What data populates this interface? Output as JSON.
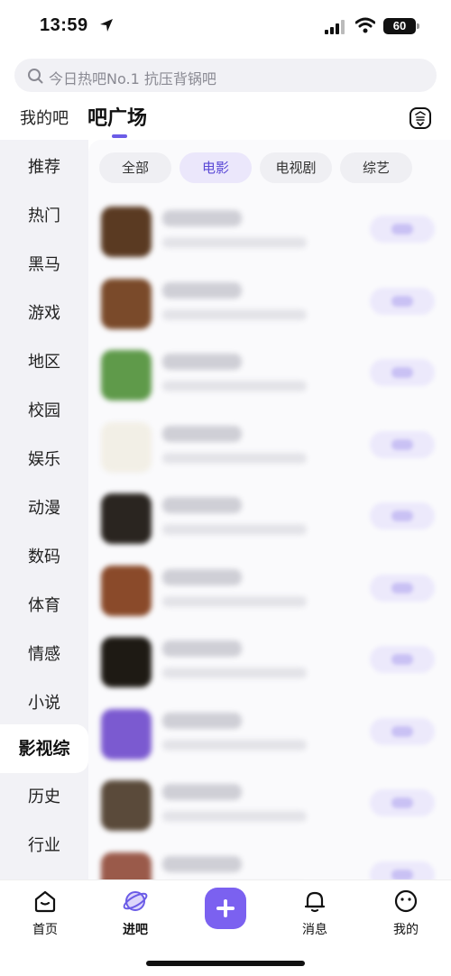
{
  "status_bar": {
    "time": "13:59",
    "battery": "60"
  },
  "search": {
    "placeholder": "今日热吧No.1 抗压背锅吧"
  },
  "top_nav": {
    "my_bars": "我的吧",
    "bar_square": "吧广场",
    "sign_in_icon": "sign-in-stamp-icon"
  },
  "left_categories": {
    "items": [
      "推荐",
      "热门",
      "黑马",
      "游戏",
      "地区",
      "校园",
      "娱乐",
      "动漫",
      "数码",
      "体育",
      "情感",
      "小说",
      "影视综",
      "历史",
      "行业"
    ],
    "active": "影视综"
  },
  "chips": {
    "items": [
      "全部",
      "电影",
      "电视剧",
      "综艺"
    ],
    "active": "电影"
  },
  "bar_list": {
    "rows": [
      {
        "avatar_color": "#5a3a22"
      },
      {
        "avatar_color": "#7a4a2a"
      },
      {
        "avatar_color": "#5f9a4a"
      },
      {
        "avatar_color": "#f2efe6"
      },
      {
        "avatar_color": "#2a2520"
      },
      {
        "avatar_color": "#8a4a2a"
      },
      {
        "avatar_color": "#1e1a14"
      },
      {
        "avatar_color": "#7b5ad0"
      },
      {
        "avatar_color": "#5a4a3a"
      },
      {
        "avatar_color": "#9a5a4a"
      }
    ]
  },
  "tab_bar": {
    "home": "首页",
    "enter_bar": "进吧",
    "messages": "消息",
    "mine": "我的"
  },
  "colors": {
    "accent": "#6b5ce7",
    "plus_button": "#7b61f0",
    "sidebar_bg": "#f2f2f6"
  }
}
